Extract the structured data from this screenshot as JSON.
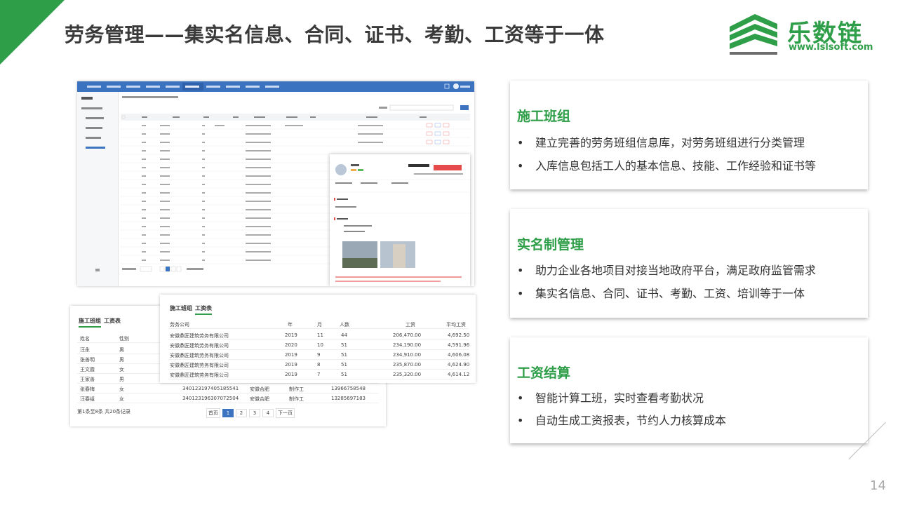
{
  "header": {
    "title": "劳务管理——集实名信息、合同、证书、考勤、工资等于一体"
  },
  "logo": {
    "name": "乐数链",
    "url": "www.lslsoft.com",
    "color": "#2e9e48"
  },
  "colors": {
    "accent": "#2e9e48",
    "app_blue": "#3b73c0",
    "danger": "#e54b4b"
  },
  "wage_table": {
    "tabs": [
      "施工班组",
      "工资表"
    ],
    "active_tab": "工资表",
    "columns": [
      "劳务公司",
      "年",
      "月",
      "人数",
      "工资",
      "平均工资"
    ],
    "rows": [
      [
        "安徽鼎匠建筑劳务有限公司",
        "2019",
        "11",
        "44",
        "206,470.00",
        "4,692.50"
      ],
      [
        "安徽鼎匠建筑劳务有限公司",
        "2020",
        "10",
        "51",
        "234,190.00",
        "4,591.96"
      ],
      [
        "安徽鼎匠建筑劳务有限公司",
        "2019",
        "9",
        "51",
        "234,910.00",
        "4,606.08"
      ],
      [
        "安徽鼎匠建筑劳务有限公司",
        "2019",
        "8",
        "51",
        "235,870.00",
        "4,624.90"
      ],
      [
        "安徽鼎匠建筑劳务有限公司",
        "2019",
        "7",
        "51",
        "235,320.00",
        "4,614.12"
      ]
    ]
  },
  "worker_table": {
    "tabs": [
      "施工班组",
      "工资表"
    ],
    "active_tab": "施工班组",
    "columns": [
      "姓名",
      "性别"
    ],
    "rows": [
      [
        "汪永",
        "男",
        "",
        "",
        "",
        ""
      ],
      [
        "张善明",
        "男",
        "",
        "",
        "",
        ""
      ],
      [
        "王文霞",
        "女",
        "",
        "",
        "",
        ""
      ],
      [
        "王家善",
        "男",
        "",
        "",
        "",
        ""
      ],
      [
        "张春梅",
        "女",
        "340123197405185541",
        "安徽合肥",
        "制作工",
        "13966758548"
      ],
      [
        "汪春组",
        "女",
        "340123196307072504",
        "安徽合肥",
        "制作工",
        "13285697183"
      ]
    ],
    "summary": "第1条至8条 共20条记录",
    "pager": {
      "prev": "首页",
      "pages": [
        "1",
        "2",
        "3",
        "4"
      ],
      "current": "1",
      "next": "下一页"
    }
  },
  "cards": [
    {
      "heading": "施工班组",
      "bullets": [
        "建立完善的劳务班组信息库，对劳务班组进行分类管理",
        "入库信息包括工人的基本信息、技能、工作经验和证书等"
      ]
    },
    {
      "heading": "实名制管理",
      "bullets": [
        "助力企业各地项目对接当地政府平台，满足政府监管需求",
        "集实名信息、合同、证书、考勤、工资、培训等于一体"
      ]
    },
    {
      "heading": "工资结算",
      "bullets": [
        "智能计算工班，实时查看考勤状况",
        "自动生成工资报表，节约人力核算成本"
      ]
    }
  ],
  "bullet_symbol": "•",
  "page_number": "14"
}
